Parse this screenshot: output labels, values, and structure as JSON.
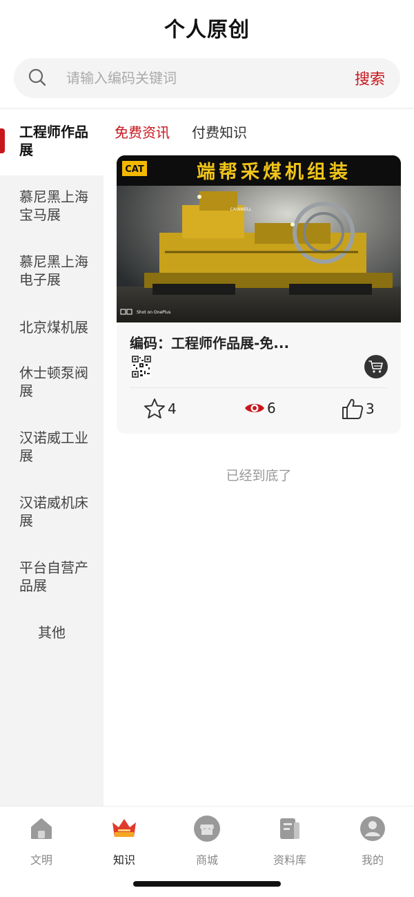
{
  "header": {
    "title": "个人原创"
  },
  "search": {
    "placeholder": "请输入编码关键词",
    "button_label": "搜索"
  },
  "sidebar": {
    "items": [
      {
        "label": "工程师作品展",
        "active": true
      },
      {
        "label": "慕尼黑上海宝马展"
      },
      {
        "label": "慕尼黑上海电子展"
      },
      {
        "label": "北京煤机展"
      },
      {
        "label": "休士顿泵阀展"
      },
      {
        "label": "汉诺威工业展"
      },
      {
        "label": "汉诺威机床展"
      },
      {
        "label": "平台自营产品展"
      },
      {
        "label": "其他"
      }
    ]
  },
  "tabs": [
    {
      "label": "免费资讯",
      "active": true
    },
    {
      "label": "付费知识"
    }
  ],
  "card": {
    "image_banner_text": "端帮采煤机组装",
    "image_logo_text": "CAT",
    "image_watermark": "Shot on OnePlus",
    "image_body_label": "CAINWELL",
    "title": "编码：工程师作品展-免...",
    "favorites": "4",
    "views": "6",
    "likes": "3"
  },
  "list_end_text": "已经到底了",
  "tabbar": {
    "items": [
      {
        "label": "文明",
        "icon": "home-icon"
      },
      {
        "label": "知识",
        "icon": "crown-icon",
        "active": true
      },
      {
        "label": "商城",
        "icon": "shop-icon"
      },
      {
        "label": "资料库",
        "icon": "library-icon"
      },
      {
        "label": "我的",
        "icon": "profile-icon"
      }
    ]
  },
  "colors": {
    "accent": "#c8161d",
    "sidebar_bg": "#f3f3f3",
    "card_bg": "#f7f7f7"
  }
}
